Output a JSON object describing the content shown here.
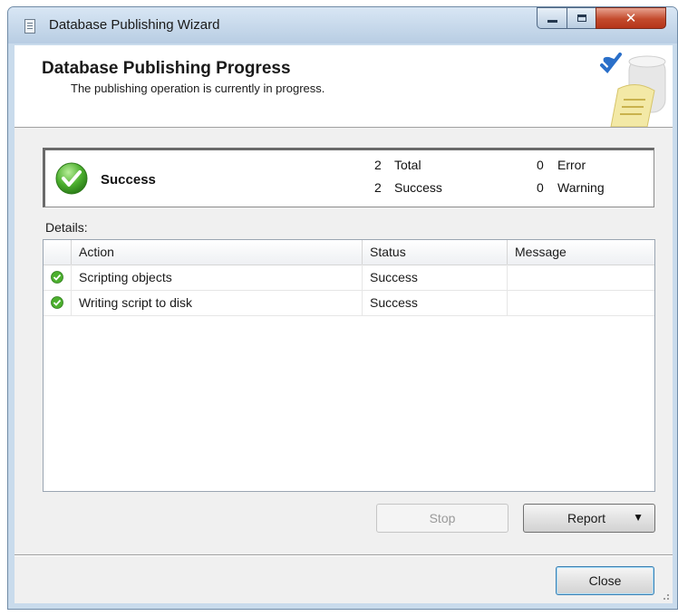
{
  "window": {
    "title": "Database Publishing Wizard"
  },
  "header": {
    "title": "Database Publishing Progress",
    "subtitle": "The publishing operation is currently in progress."
  },
  "summary": {
    "status": "Success",
    "total_count": "2",
    "total_label": "Total",
    "success_count": "2",
    "success_label": "Success",
    "error_count": "0",
    "error_label": "Error",
    "warning_count": "0",
    "warning_label": "Warning"
  },
  "details": {
    "label": "Details:",
    "columns": [
      "Action",
      "Status",
      "Message"
    ],
    "rows": [
      {
        "action": "Scripting objects",
        "status": "Success",
        "message": ""
      },
      {
        "action": "Writing script to disk",
        "status": "Success",
        "message": ""
      }
    ]
  },
  "buttons": {
    "stop": "Stop",
    "report": "Report",
    "close": "Close"
  },
  "icons": {
    "app": "database-icon",
    "status": "success-check-icon",
    "header_art": "scroll-check-icon",
    "dropdown": "dropdown-arrow-icon"
  },
  "colors": {
    "success": "#4caf2e",
    "accent": "#2a6fc9"
  }
}
